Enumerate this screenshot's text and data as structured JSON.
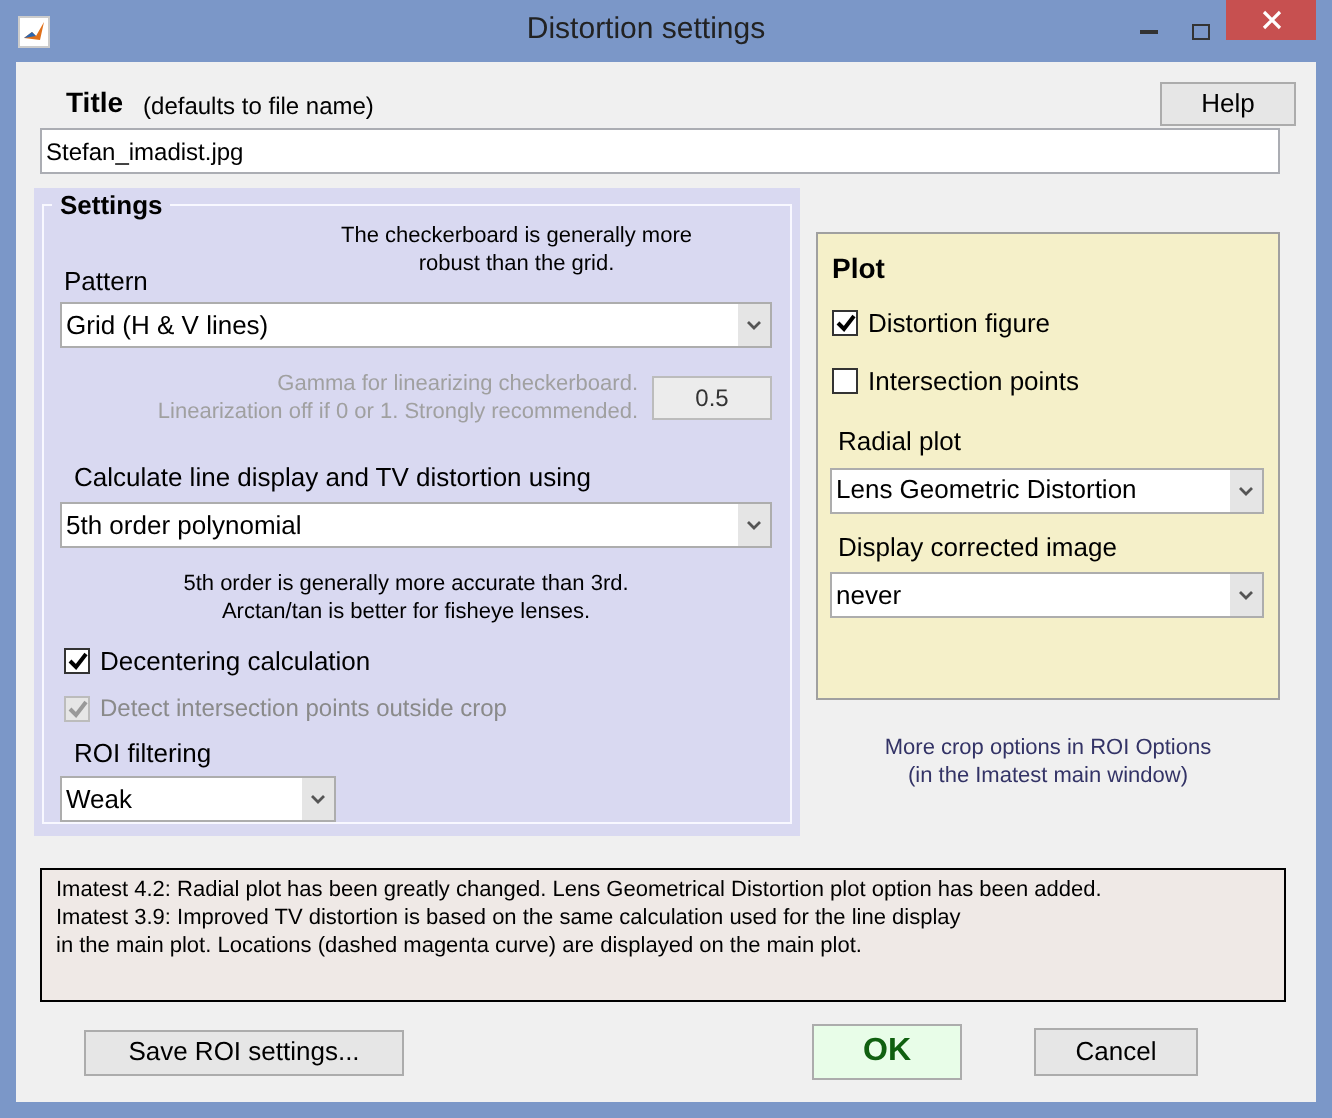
{
  "window": {
    "title": "Distortion settings"
  },
  "header": {
    "title_label": "Title",
    "title_hint": "(defaults to file name)",
    "help_button": "Help",
    "title_field": "Stefan_imadist.jpg"
  },
  "settings": {
    "heading": "Settings",
    "pattern_note": "The checkerboard is generally more\nrobust than the grid.",
    "pattern": {
      "label": "Pattern",
      "value": "Grid  (H & V lines)"
    },
    "gamma": {
      "label": "Gamma for linearizing checkerboard.\nLinearization off if 0 or 1. Strongly recommended.",
      "value": "0.5",
      "disabled": true
    },
    "method": {
      "label": "Calculate line display and TV distortion using",
      "value": "5th order polynomial"
    },
    "method_note": "5th order is generally more accurate than 3rd.\nArctan/tan is better for fisheye lenses.",
    "checkboxes": [
      {
        "label": "Decentering calculation",
        "checked": true,
        "disabled": false
      },
      {
        "label": "Detect intersection points outside crop",
        "checked": true,
        "disabled": true
      }
    ],
    "roi_filtering": {
      "label": "ROI filtering",
      "value": "Weak"
    }
  },
  "plot": {
    "heading": "Plot",
    "checkboxes": [
      {
        "label": "Distortion figure",
        "checked": true
      },
      {
        "label": "Intersection points",
        "checked": false
      }
    ],
    "radial_plot": {
      "label": "Radial plot",
      "value": "Lens Geometric Distortion"
    },
    "display_corrected": {
      "label": "Display corrected image",
      "value": "never"
    }
  },
  "crop_note": "More crop options in ROI Options\n(in the Imatest main window)",
  "info": "Imatest 4.2:  Radial plot has been greatly changed. Lens Geometrical Distortion plot option has been added.\nImatest 3.9:  Improved TV distortion is based on the same calculation used for the line display\nin the main plot. Locations (dashed magenta curve) are displayed on the main plot.",
  "buttons": {
    "save": "Save ROI settings...",
    "ok": "OK",
    "cancel": "Cancel"
  }
}
